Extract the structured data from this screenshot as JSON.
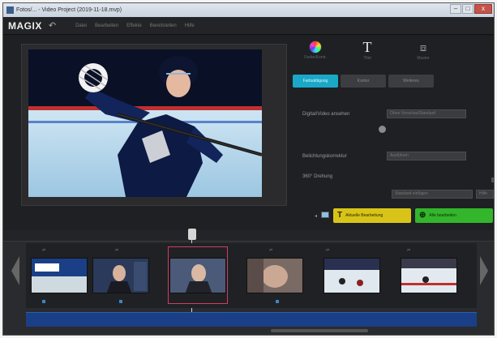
{
  "window": {
    "title": "Fotos/... - Video Project (2019-11-18.mvp)",
    "controls": {
      "minimize": "–",
      "maximize": "□",
      "close": "x"
    }
  },
  "menubar": {
    "logo": "MAGIX",
    "undo": "↶",
    "menus": [
      "Datei",
      "Bearbeiten",
      "Effekte",
      "Bereitstellen",
      "Hilfe"
    ]
  },
  "tools": [
    {
      "label": "Farbe/Kontr.",
      "icon": "color-wheel-icon"
    },
    {
      "label": "Titel",
      "icon": "text-icon"
    },
    {
      "label": "Muster",
      "icon": "stamp-icon"
    }
  ],
  "tabs": [
    {
      "label": "Farbsättigung",
      "active": true
    },
    {
      "label": "Kontur",
      "active": false
    },
    {
      "label": "Weiteres",
      "active": false
    }
  ],
  "properties": {
    "row1_label": "Digital/Video ansehen",
    "row1_value": "Ohne Vorschau/Standard",
    "row2_label": "Belichtungskorrektur",
    "row2_value": "Ausführen",
    "row3_label": "360° Drehung",
    "row4_button": "Standard einfügen",
    "row4_small": "Hilfe"
  },
  "actions": {
    "yellow_label": "Aktuelle Bearbeitung",
    "green_label": "Alle bearbeiten"
  },
  "storyboard": {
    "clip_count": 6,
    "selected_index": 2
  },
  "colors": {
    "accent": "#1aa8c8",
    "yellow": "#d8c418",
    "green": "#33b52c",
    "selection": "#cc3d62",
    "audio": "#1a3f86"
  }
}
